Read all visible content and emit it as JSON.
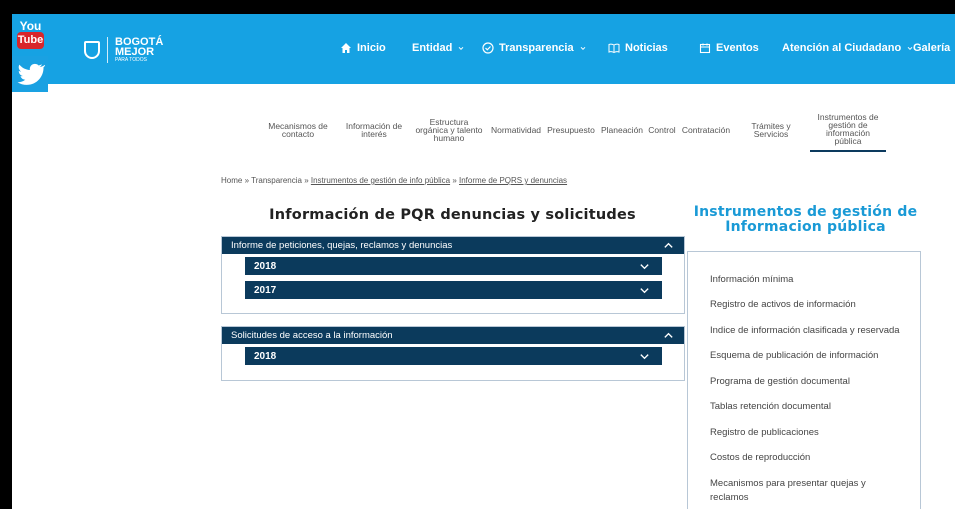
{
  "social": {
    "youtube_top": "You",
    "youtube_bottom": "Tube"
  },
  "logo": {
    "line1": "BOGOTÁ",
    "line2": "MEJOR",
    "line3": "PARA TODOS"
  },
  "nav": {
    "inicio": "Inicio",
    "entidad": "Entidad",
    "transparencia": "Transparencia",
    "noticias": "Noticias",
    "eventos": "Eventos",
    "atencion": "Atención al Ciudadano",
    "galeria": "Galería"
  },
  "subnav": {
    "mecanismos_1": "Mecanismos de",
    "mecanismos_2": "contacto",
    "informacion_1": "Información de",
    "informacion_2": "interés",
    "estructura_1": "Estructura",
    "estructura_2": "orgánica y talento",
    "estructura_3": "humano",
    "normatividad": "Normatividad",
    "presupuesto": "Presupuesto",
    "planeacion": "Planeación",
    "control": "Control",
    "contratacion": "Contratación",
    "tramites_1": "Trámites y",
    "tramites_2": "Servicios",
    "instrumentos_1": "Instrumentos de",
    "instrumentos_2": "gestión de",
    "instrumentos_3": "información",
    "instrumentos_4": "pública"
  },
  "breadcrumb": {
    "home": "Home",
    "sep": "»",
    "transparencia": "Transparencia",
    "instrumentos": "Instrumentos de gestión de info pública",
    "informe": "Informe de PQRS y denuncias"
  },
  "main": {
    "title": "Información de PQR denuncias y solicitudes",
    "panel1_title": "Informe de peticiones, quejas, reclamos y denuncias",
    "panel1_year1": "2018",
    "panel1_year2": "2017",
    "panel2_title": "Solicitudes de acceso a la información",
    "panel2_year1": "2018"
  },
  "sidebar": {
    "title_1": "Instrumentos de gestión de",
    "title_2": "Informacion pública",
    "items": [
      "Información mínima",
      "Registro de activos de información",
      "Indice de información clasificada y reservada",
      "Esquema de publicación de información",
      "Programa de gestión documental",
      "Tablas retención documental",
      "Registro de publicaciones",
      "Costos de reproducción",
      "Mecanismos para presentar quejas y reclamos"
    ]
  },
  "colors": {
    "header": "#16a2e3",
    "navy": "#0b3a5c",
    "accent": "#1a9ad6"
  }
}
